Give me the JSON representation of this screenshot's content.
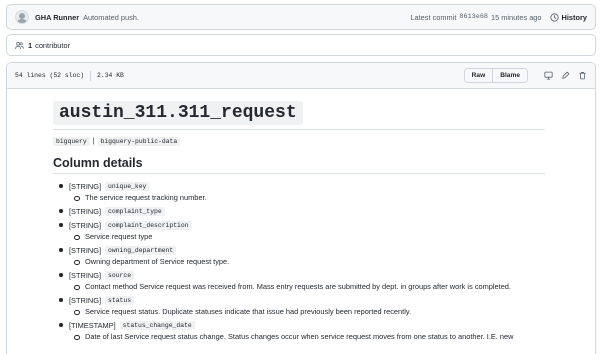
{
  "commit": {
    "author": "GHA Runner",
    "message": "Automated push.",
    "latest_label": "Latest commit",
    "sha": "8613e68",
    "time": "15 minutes ago",
    "history_label": "History"
  },
  "contributors": {
    "count": "1",
    "label": "contributor"
  },
  "file": {
    "lines": "54 lines (52 sloc)",
    "size": "2.34 KB",
    "raw_label": "Raw",
    "blame_label": "Blame"
  },
  "doc": {
    "title": "austin_311.311_request",
    "tags": [
      "bigquery",
      "bigquery-public-data"
    ],
    "tag_separator": "|",
    "section_heading": "Column details",
    "columns": [
      {
        "type": "[STRING]",
        "name": "unique_key",
        "description": "The service request tracking number."
      },
      {
        "type": "[STRING]",
        "name": "complaint_type",
        "description": ""
      },
      {
        "type": "[STRING]",
        "name": "complaint_description",
        "description": "Service request type"
      },
      {
        "type": "[STRING]",
        "name": "owning_department",
        "description": "Owning department of Service request type."
      },
      {
        "type": "[STRING]",
        "name": "source",
        "description": "Contact method Service request was received from. Mass entry requests are submitted by dept. in groups after work is completed."
      },
      {
        "type": "[STRING]",
        "name": "status",
        "description": "Service request status. Duplicate statuses indicate that issue had previously been reported recently."
      },
      {
        "type": "[TIMESTAMP]",
        "name": "status_change_date",
        "description": "Date of last Service request status change. Status changes occur when service request moves from one status to another. I.E. new"
      }
    ]
  },
  "icons": {
    "history": "clock-history-icon",
    "contributors": "people-icon",
    "display": "desktop-icon",
    "edit": "pencil-icon",
    "delete": "trash-icon"
  },
  "colors": {
    "header_bg": "#f6f8fa",
    "border": "#d0d7de",
    "code_bg": "#eff1f3",
    "text": "#24292f",
    "muted": "#57606a"
  }
}
